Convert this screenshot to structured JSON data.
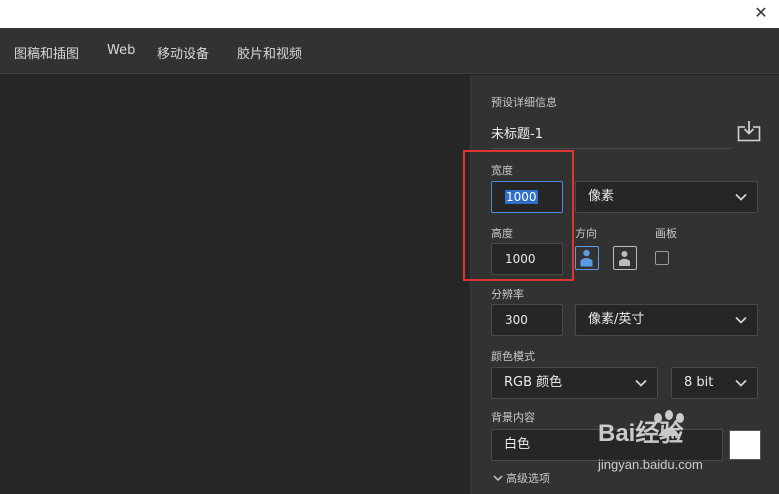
{
  "titlebar": {
    "close_glyph": "✕"
  },
  "tabs": [
    {
      "label": "图稿和插图"
    },
    {
      "label": "Web"
    },
    {
      "label": "移动设备"
    },
    {
      "label": "胶片和视频"
    }
  ],
  "panel": {
    "section_title": "预设详细信息",
    "preset_name": "未标题-1",
    "width": {
      "label": "宽度",
      "value": "1000",
      "unit": "像素"
    },
    "height": {
      "label": "高度",
      "value": "1000"
    },
    "orientation": {
      "label": "方向",
      "selected": "portrait"
    },
    "artboard": {
      "label": "画板",
      "checked": false
    },
    "resolution": {
      "label": "分辨率",
      "value": "300",
      "unit": "像素/英寸"
    },
    "color_mode": {
      "label": "颜色模式",
      "mode": "RGB 颜色",
      "depth": "8 bit"
    },
    "background": {
      "label": "背景内容",
      "value": "白色",
      "swatch_color": "#ffffff"
    },
    "advanced": {
      "label": "高级选项"
    }
  },
  "watermark": {
    "brand": "Bai经验",
    "site": "jingyan.baidu.com"
  },
  "colors": {
    "accent": "#4b8bd8",
    "highlight": "#e03333"
  }
}
